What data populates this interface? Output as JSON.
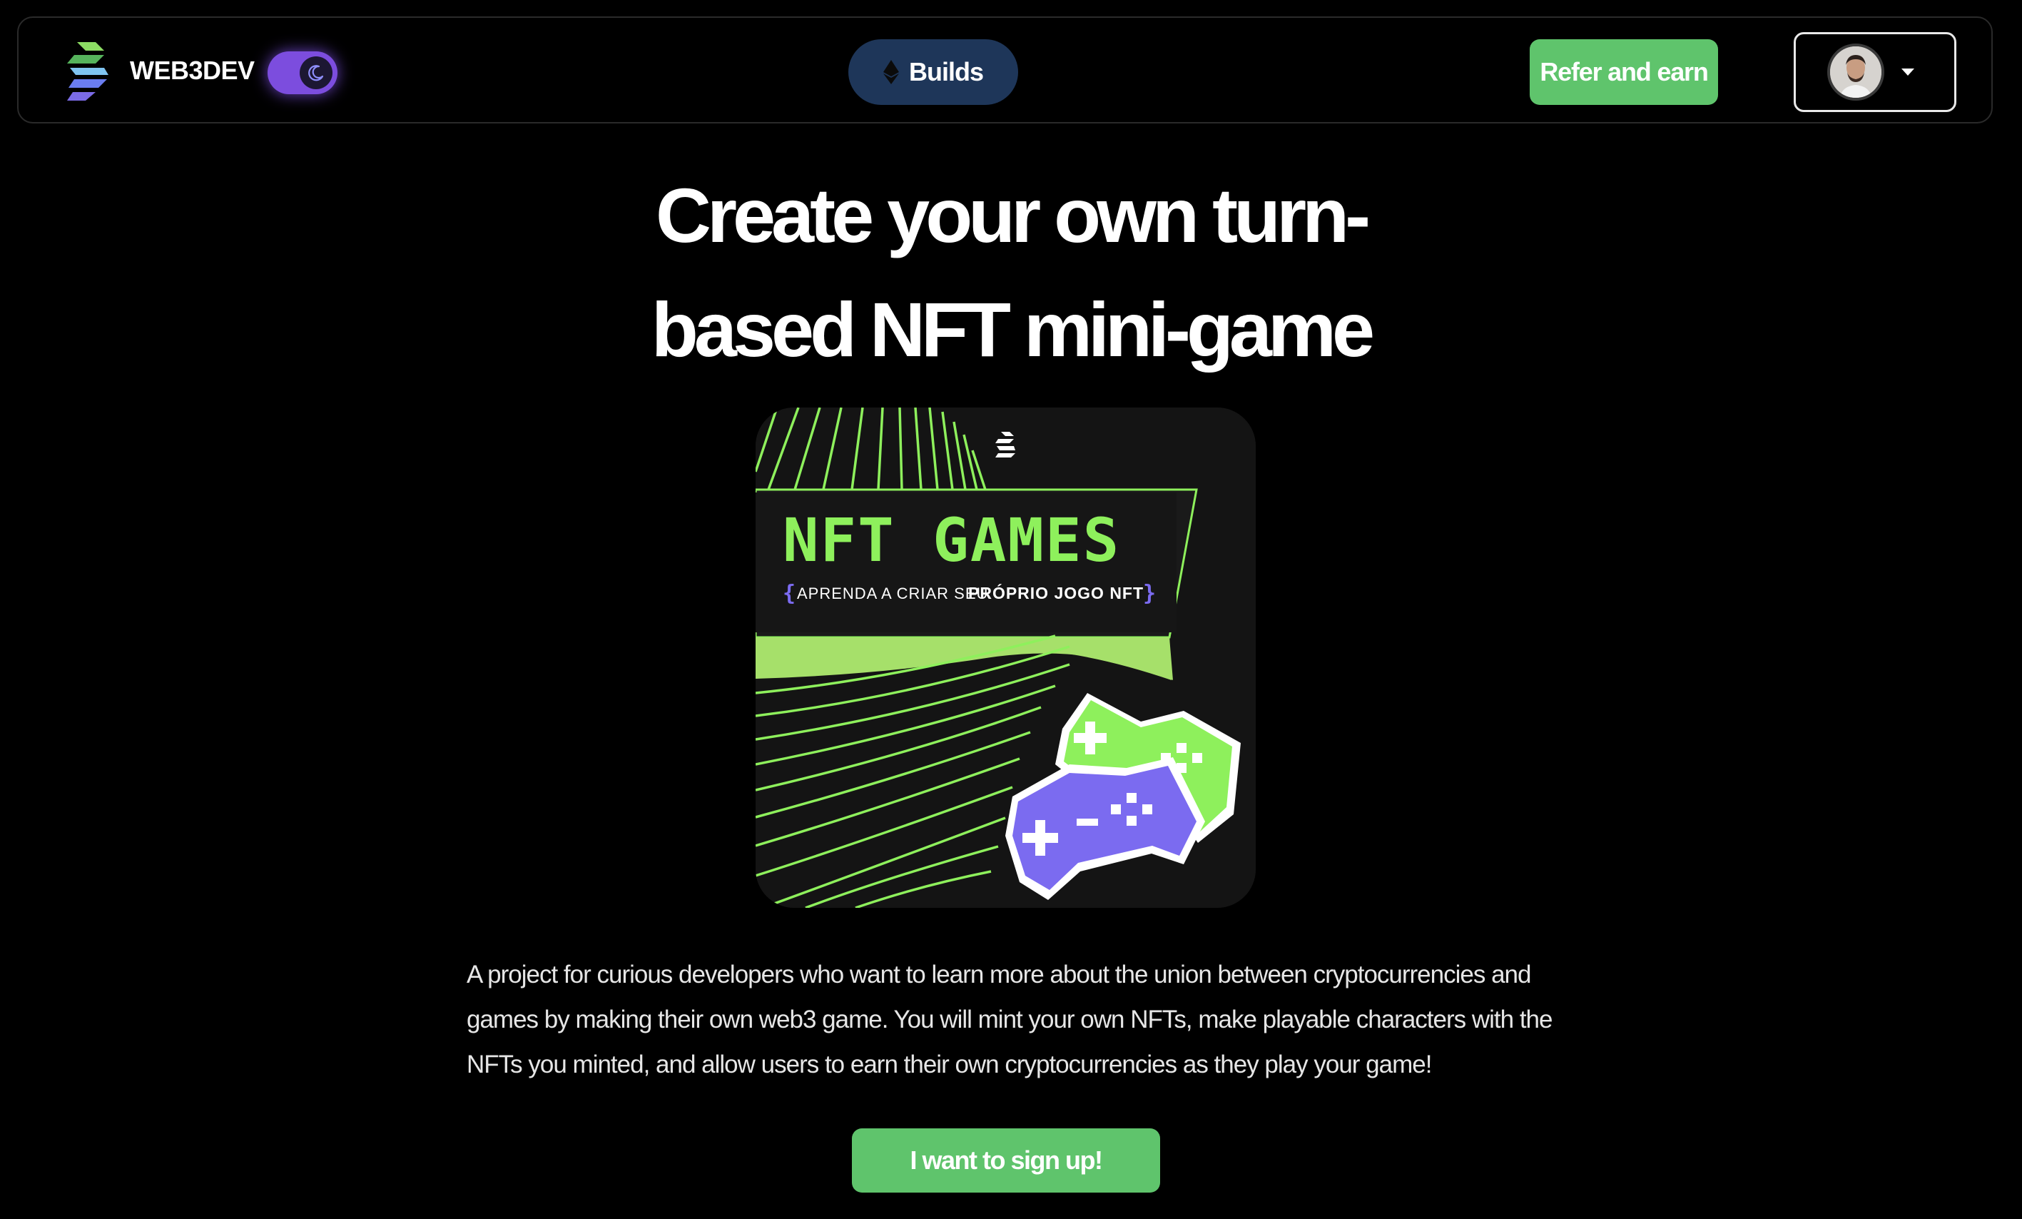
{
  "brand": {
    "name": "WEB3DEV",
    "logo_icon": "web3dev-logo-icon"
  },
  "nav": {
    "theme_toggle": {
      "state": "dark",
      "icon": "moon-icon"
    },
    "builds_label": "Builds",
    "builds_icon": "ethereum-icon",
    "refer_label": "Refer and earn",
    "profile_icon": "chevron-down-icon"
  },
  "hero": {
    "title_line1": "Create your own turn-",
    "title_line2": "based NFT mini-game",
    "image": {
      "headline": "NFT GAMES",
      "tagline_prefix": "APRENDA A CRIAR SEU",
      "tagline_bold": "PRÓPRIO JOGO NFT"
    },
    "description": "A project for curious developers who want to learn more about the union between cryptocurrencies and games by making their own web3 game. You will mint your own NFTs, make playable characters with the NFTs you minted, and allow users to earn their own cryptocurrencies as they play your game!",
    "cta_label": "I want to sign up!"
  },
  "colors": {
    "background": "#000000",
    "accent_green": "#5fc46c",
    "builds_blue": "#1e3659",
    "toggle_purple": "#7c4dde",
    "neon_green": "#8ef05c",
    "neon_purple": "#7b6bf0"
  }
}
